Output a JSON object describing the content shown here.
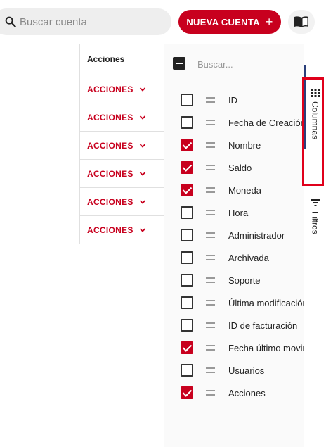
{
  "toolbar": {
    "search_placeholder": "Buscar cuenta",
    "new_button_label": "NUEVA CUENTA",
    "new_button_icon": "plus-icon",
    "book_icon": "book-icon",
    "accent_color": "#c8001e"
  },
  "grid": {
    "actions_header": "Acciones",
    "rows": [
      {
        "label": "ACCIONES"
      },
      {
        "label": "ACCIONES"
      },
      {
        "label": "ACCIONES"
      },
      {
        "label": "ACCIONES"
      },
      {
        "label": "ACCIONES"
      },
      {
        "label": "ACCIONES"
      }
    ]
  },
  "column_panel": {
    "search_placeholder": "Buscar...",
    "columns": [
      {
        "label": "ID",
        "checked": false
      },
      {
        "label": "Fecha de Creación",
        "checked": false
      },
      {
        "label": "Nombre",
        "checked": true
      },
      {
        "label": "Saldo",
        "checked": true
      },
      {
        "label": "Moneda",
        "checked": true
      },
      {
        "label": "Hora",
        "checked": false
      },
      {
        "label": "Administrador",
        "checked": false
      },
      {
        "label": "Archivada",
        "checked": false
      },
      {
        "label": "Soporte",
        "checked": false
      },
      {
        "label": "Última modificación",
        "checked": false
      },
      {
        "label": "ID de facturación",
        "checked": false
      },
      {
        "label": "Fecha último movimiento",
        "checked": true
      },
      {
        "label": "Usuarios",
        "checked": false
      },
      {
        "label": "Acciones",
        "checked": true
      }
    ]
  },
  "sidebar": {
    "columns_tab": "Columnas",
    "filters_tab": "Filtros"
  }
}
